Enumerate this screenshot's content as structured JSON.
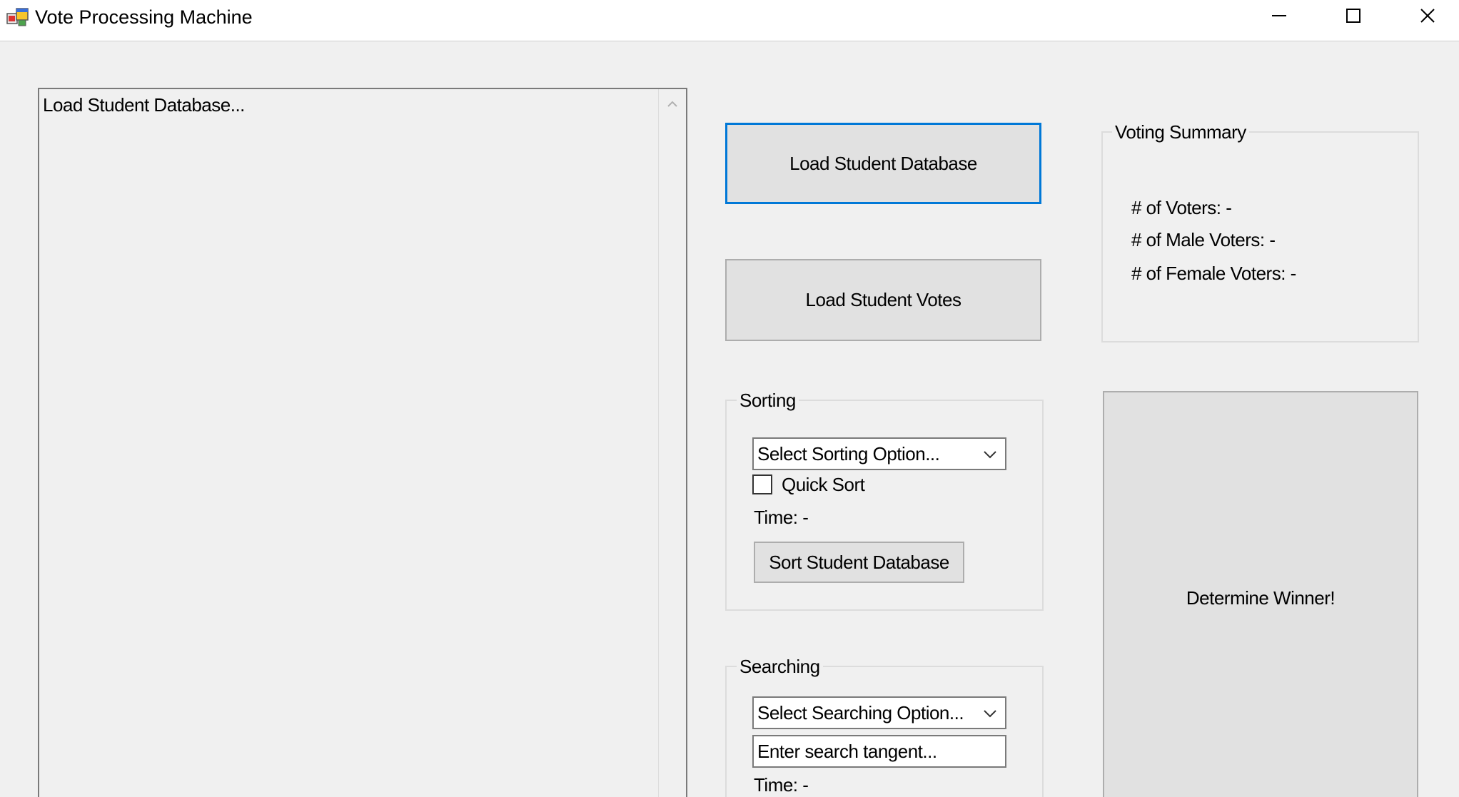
{
  "window": {
    "title": "Vote Processing Machine",
    "icon": "app-icon",
    "controls": [
      "minimize-icon",
      "maximize-icon",
      "close-icon"
    ]
  },
  "output_box": {
    "text": "Load Student Database..."
  },
  "buttons": {
    "load_database": "Load Student Database",
    "load_votes": "Load Student Votes",
    "sort_database": "Sort Student Database",
    "determine_winner": "Determine Winner!"
  },
  "voting_summary": {
    "title": "Voting Summary",
    "voters": "# of Voters:  -",
    "male_voters": "# of Male Voters:  -",
    "female_voters": "# of Female Voters:  -"
  },
  "sorting": {
    "title": "Sorting",
    "select_value": "Select Sorting Option...",
    "quicksort_label": "Quick Sort",
    "quicksort_checked": false,
    "time_label": "Time:    -"
  },
  "searching": {
    "title": "Searching",
    "select_value": "Select Searching Option...",
    "search_input_value": "Enter search tangent...",
    "time_label": "Time:    -"
  },
  "colors": {
    "focus_border": "#0078d7",
    "window_bg": "#f0f0f0",
    "button_bg": "#e1e1e1"
  }
}
